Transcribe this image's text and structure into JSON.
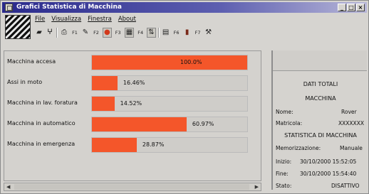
{
  "window": {
    "title": "Grafici Statistica di Macchina",
    "controls": [
      "_",
      "□",
      "×"
    ]
  },
  "menu": [
    "File",
    "Visualizza",
    "Finestra",
    "About"
  ],
  "toolbar": [
    {
      "icon": "folder-icon",
      "label": ""
    },
    {
      "icon": "filter-icon",
      "label": ""
    },
    {
      "icon": "print-icon",
      "label": ""
    },
    {
      "icon": "f1-button",
      "label": "F1"
    },
    {
      "icon": "edit-icon",
      "label": ""
    },
    {
      "icon": "f2-button",
      "label": "F2"
    },
    {
      "icon": "stop-icon",
      "label": ""
    },
    {
      "icon": "f3-button",
      "label": "F3"
    },
    {
      "icon": "grid-icon",
      "label": ""
    },
    {
      "icon": "f4-button",
      "label": "F4"
    },
    {
      "icon": "filter-icon",
      "label": ""
    },
    {
      "icon": "table-icon",
      "label": ""
    },
    {
      "icon": "f6-button",
      "label": "F6"
    },
    {
      "icon": "book-icon",
      "label": ""
    },
    {
      "icon": "f7-button",
      "label": "F7"
    },
    {
      "icon": "tool-icon",
      "label": ""
    }
  ],
  "stats": [
    {
      "label": "Macchina accesa",
      "percent": "100.0%",
      "value": 100.0
    },
    {
      "label": "Assi in moto",
      "percent": "16.46%",
      "value": 16.46
    },
    {
      "label": "Macchina in lav. foratura",
      "percent": "14.52%",
      "value": 14.52
    },
    {
      "label": "Macchina in automatico",
      "percent": "60.97%",
      "value": 60.97
    },
    {
      "label": "Macchina in emergenza",
      "percent": "28.87%",
      "value": 28.87
    }
  ],
  "colors": {
    "bar": "#f4562a",
    "title_bar": "#2a2a8c"
  },
  "summary": {
    "header": "DATI TOTALI",
    "machine_header": "MACCHINA",
    "name_label": "Nome:",
    "name_value": "Rover",
    "serial_label": "Matricola:",
    "serial_value": "XXXXXXX",
    "stats_header": "STATISTICA DI MACCHINA",
    "memo_label": "Memorizzazione:",
    "memo_value": "Manuale",
    "start_label": "Inizio:",
    "start_value": "30/10/2000 15:52:05",
    "end_label": "Fine:",
    "end_value": "30/10/2000 15:54:40",
    "state_label": "Stato:",
    "state_value": "DISATTIVO"
  }
}
